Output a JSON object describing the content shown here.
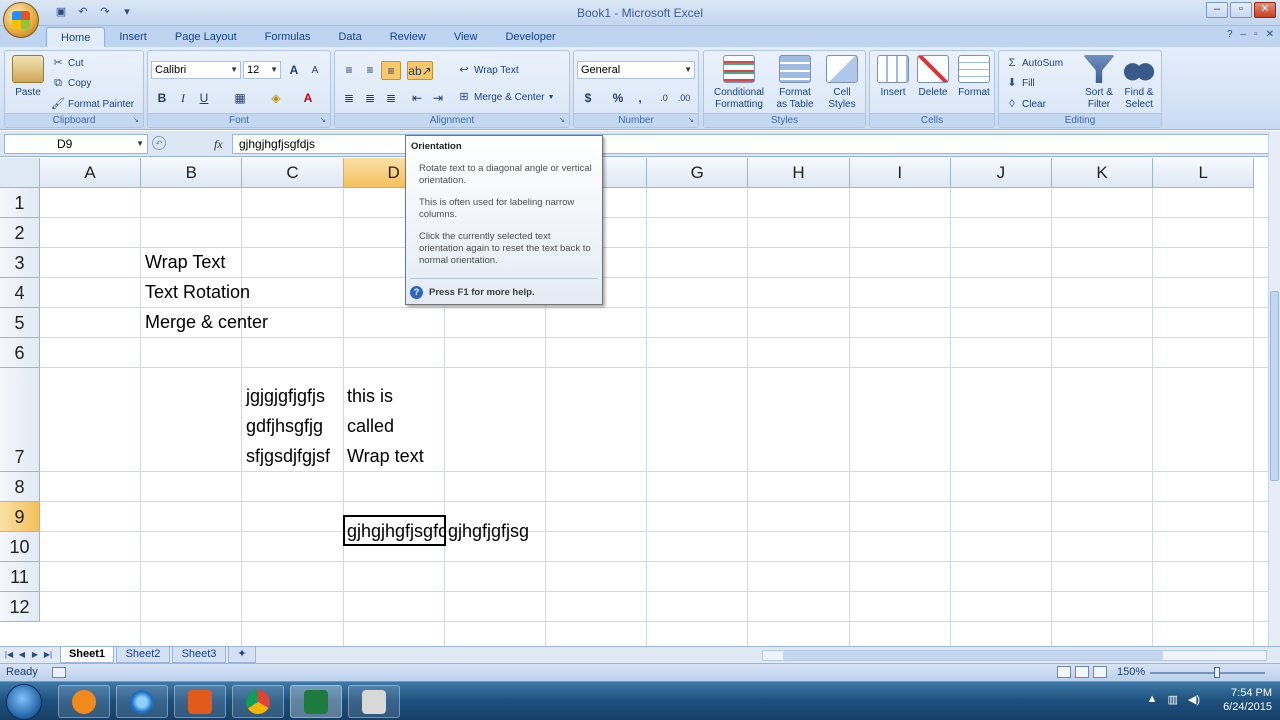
{
  "window": {
    "title": "Book1 - Microsoft Excel",
    "controls": [
      "–",
      "▫",
      "✕"
    ]
  },
  "ribbon_tabs": [
    "Home",
    "Insert",
    "Page Layout",
    "Formulas",
    "Data",
    "Review",
    "View",
    "Developer"
  ],
  "clipboard": {
    "paste": "Paste",
    "cut": "Cut",
    "copy": "Copy",
    "format_painter": "Format Painter",
    "label": "Clipboard"
  },
  "font": {
    "name": "Calibri",
    "size": "12",
    "bold": "B",
    "italic": "I",
    "underline": "U",
    "grow": "A",
    "shrink": "A",
    "label": "Font"
  },
  "alignment": {
    "wrap_text": "Wrap Text",
    "merge_center": "Merge & Center",
    "label": "Alignment"
  },
  "number": {
    "format": "General",
    "currency": "$",
    "percent": "%",
    "comma": ",",
    "label": "Number"
  },
  "styles": {
    "conditional": "Conditional",
    "conditional2": "Formatting",
    "format_as": "Format",
    "format_as2": "as Table",
    "cell": "Cell",
    "cell2": "Styles",
    "label": "Styles"
  },
  "cells": {
    "insert": "Insert",
    "delete": "Delete",
    "format": "Format",
    "label": "Cells"
  },
  "editing": {
    "autosum": "AutoSum",
    "fill": "Fill",
    "clear": "Clear",
    "sort": "Sort &",
    "sort2": "Filter",
    "find": "Find &",
    "find2": "Select",
    "label": "Editing"
  },
  "formula_bar": {
    "name_box": "D9",
    "fx": "fx",
    "value": "gjhgjhgfjsgfdjs"
  },
  "columns": [
    "A",
    "B",
    "C",
    "D",
    "E",
    "F",
    "G",
    "H",
    "I",
    "J",
    "K",
    "L"
  ],
  "selected_column": "D",
  "rows": [
    "1",
    "2",
    "3",
    "4",
    "5",
    "6",
    "7",
    "8",
    "9",
    "10",
    "11",
    "12"
  ],
  "selected_row": "9",
  "cell_text": {
    "b3": "Wrap Text",
    "b4": "Text Rotation",
    "b5": "Merge & center",
    "c7_line1": "jgjgjgfjgfjs",
    "c7_line2": "gdfjhsgfjg",
    "c7_line3": "sfjgsdjfgjsf",
    "d7_line1": "this is",
    "d7_line2": "called",
    "d7_line3": "Wrap text",
    "d9": "gjhgjhgfjsgfdjs",
    "e9": "gjhgfjgfjsg"
  },
  "tooltip": {
    "title": "Orientation",
    "p1": "Rotate text to a diagonal angle or vertical orientation.",
    "p2": "This is often used for labeling narrow columns.",
    "p3": "Click the currently selected text orientation again to reset the text back to normal orientation.",
    "help": "Press F1 for more help."
  },
  "sheets": [
    "Sheet1",
    "Sheet2",
    "Sheet3"
  ],
  "active_sheet": "Sheet1",
  "status": {
    "ready": "Ready",
    "zoom": "150%"
  },
  "clock": {
    "time": "7:54 PM",
    "date": "6/24/2015"
  }
}
